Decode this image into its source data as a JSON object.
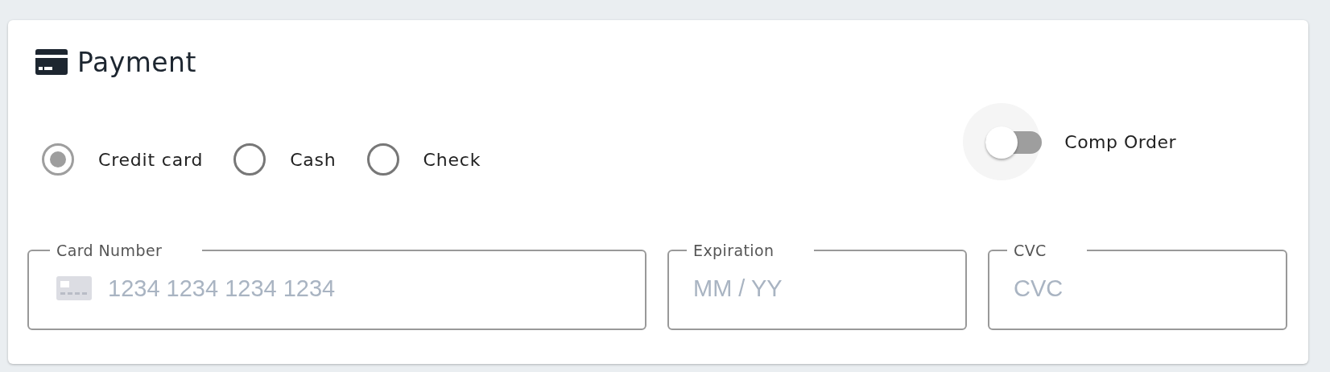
{
  "section": {
    "title": "Payment"
  },
  "payment_methods": [
    {
      "label": "Credit card",
      "selected": true
    },
    {
      "label": "Cash",
      "selected": false
    },
    {
      "label": "Check",
      "selected": false
    }
  ],
  "comp_order": {
    "label": "Comp Order",
    "on": false
  },
  "fields": [
    {
      "kind": "card",
      "label": "Card Number",
      "placeholder": "1234 1234 1234 1234"
    },
    {
      "kind": "plain",
      "label": "Expiration",
      "placeholder": "MM / YY"
    },
    {
      "kind": "plain",
      "label": "CVC",
      "placeholder": "CVC"
    }
  ]
}
